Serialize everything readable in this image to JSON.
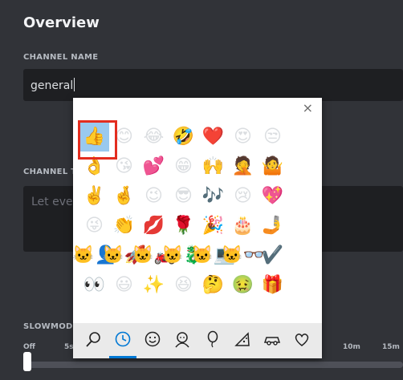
{
  "page": {
    "title": "Overview",
    "channel_name_label": "CHANNEL NAME",
    "channel_name_value": "general",
    "topic_label": "CHANNEL TOPIC",
    "topic_placeholder": "Let everyone know how to use this channel!",
    "slowmode_label": "SLOWMODE",
    "slowmode_ticks": [
      "Off",
      "5s",
      "10m",
      "15m"
    ]
  },
  "emoji_picker": {
    "close_label": "×",
    "rows": [
      [
        "👍",
        "😊",
        "😂",
        "🤣",
        "❤️",
        "😍",
        "😒"
      ],
      [
        "👌",
        "😘",
        "💕",
        "😁",
        "🙌",
        "🤦",
        "🤷"
      ],
      [
        "✌️",
        "🤞",
        "😉",
        "😎",
        "🎶",
        "😢",
        "💖"
      ],
      [
        "😜",
        "👏",
        "💋",
        "🌹",
        "🎉",
        "🎂",
        "🤳"
      ],
      [
        "🐱‍👤",
        "🐱‍🚀",
        "🐱‍🏍",
        "🐱‍🐉",
        "🐱‍💻",
        "🐱‍👓",
        "✔️"
      ],
      [
        "👀",
        "😃",
        "✨",
        "😆",
        "🤔",
        "🤢",
        "🎁"
      ]
    ],
    "selected_emoji": "👍",
    "tabs": [
      {
        "icon": "search-icon",
        "active": false
      },
      {
        "icon": "recent-clock-icon",
        "active": true
      },
      {
        "icon": "smiley-icon",
        "active": false
      },
      {
        "icon": "person-icon",
        "active": false
      },
      {
        "icon": "balloon-icon",
        "active": false
      },
      {
        "icon": "pizza-icon",
        "active": false
      },
      {
        "icon": "car-icon",
        "active": false
      },
      {
        "icon": "heart-icon",
        "active": false
      }
    ],
    "highlight_color": "#e32d1f",
    "accent_color": "#0078d4"
  }
}
